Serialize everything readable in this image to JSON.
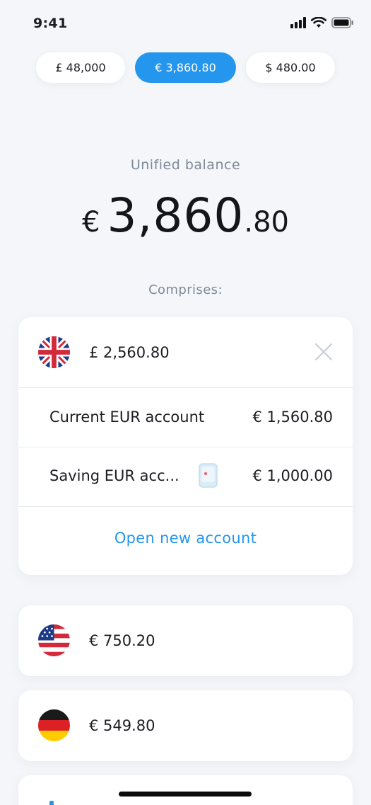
{
  "status_bar": {
    "time": "9:41"
  },
  "currency_tabs": [
    {
      "label": "£ 48,000",
      "active": false
    },
    {
      "label": "€ 3,860.80",
      "active": true
    },
    {
      "label": "$ 480.00",
      "active": false
    }
  ],
  "unified": {
    "label": "Unified balance",
    "currency_symbol": "€",
    "integer_part": "3,860",
    "decimal_part": ".80"
  },
  "comprises_label": "Comprises:",
  "uk_card": {
    "flag_icon": "uk-flag-icon",
    "amount": "£ 2,560.80",
    "accounts": [
      {
        "name": "Current EUR account",
        "amount": "€ 1,560.80"
      },
      {
        "name": "Saving EUR acc...",
        "amount": "€ 1,000.00"
      }
    ],
    "open_new_account": "Open new account"
  },
  "us_card": {
    "flag_icon": "us-flag-icon",
    "amount": "€ 750.20"
  },
  "de_card": {
    "flag_icon": "germany-flag-icon",
    "amount": "€ 549.80"
  },
  "colors": {
    "accent": "#2496ee",
    "background": "#f4f6f9",
    "muted_text": "#7f8a98"
  }
}
